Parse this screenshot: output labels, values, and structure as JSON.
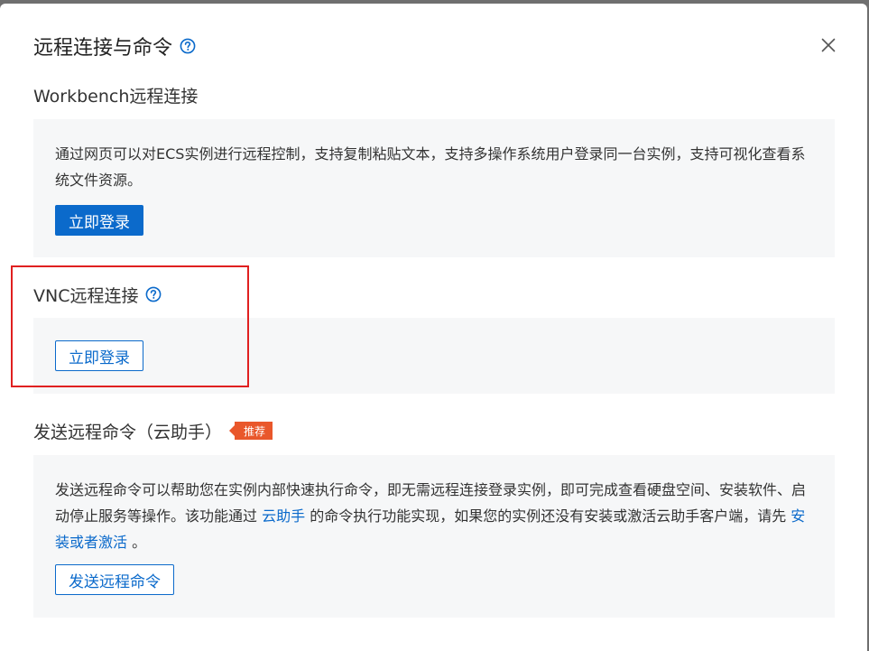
{
  "dialog": {
    "title": "远程连接与命令",
    "help_icon": "question-circle-icon",
    "close_icon": "close-icon"
  },
  "sections": {
    "workbench": {
      "title": "Workbench远程连接",
      "description": "通过网页可以对ECS实例进行远程控制，支持复制粘贴文本，支持多操作系统用户登录同一台实例，支持可视化查看系统文件资源。",
      "button_label": "立即登录"
    },
    "vnc": {
      "title": "VNC远程连接",
      "help_icon": "question-circle-icon",
      "button_label": "立即登录"
    },
    "cloud_assistant": {
      "title": "发送远程命令（云助手）",
      "badge": "推荐",
      "desc_part1": "发送远程命令可以帮助您在实例内部快速执行命令，即无需远程连接登录实例，即可完成查看硬盘空间、安装软件、启动停止服务等操作。该功能通过 ",
      "desc_link1": "云助手",
      "desc_part2": " 的命令执行功能实现，如果您的实例还没有安装或激活云助手客户端，请先 ",
      "desc_link2": "安装或者激活",
      "desc_part3": " 。",
      "button_label": "发送远程命令"
    }
  },
  "colors": {
    "primary": "#0b6acb",
    "badge": "#e9572b",
    "highlight": "#e02020",
    "panel_bg": "#f6f7f8"
  }
}
